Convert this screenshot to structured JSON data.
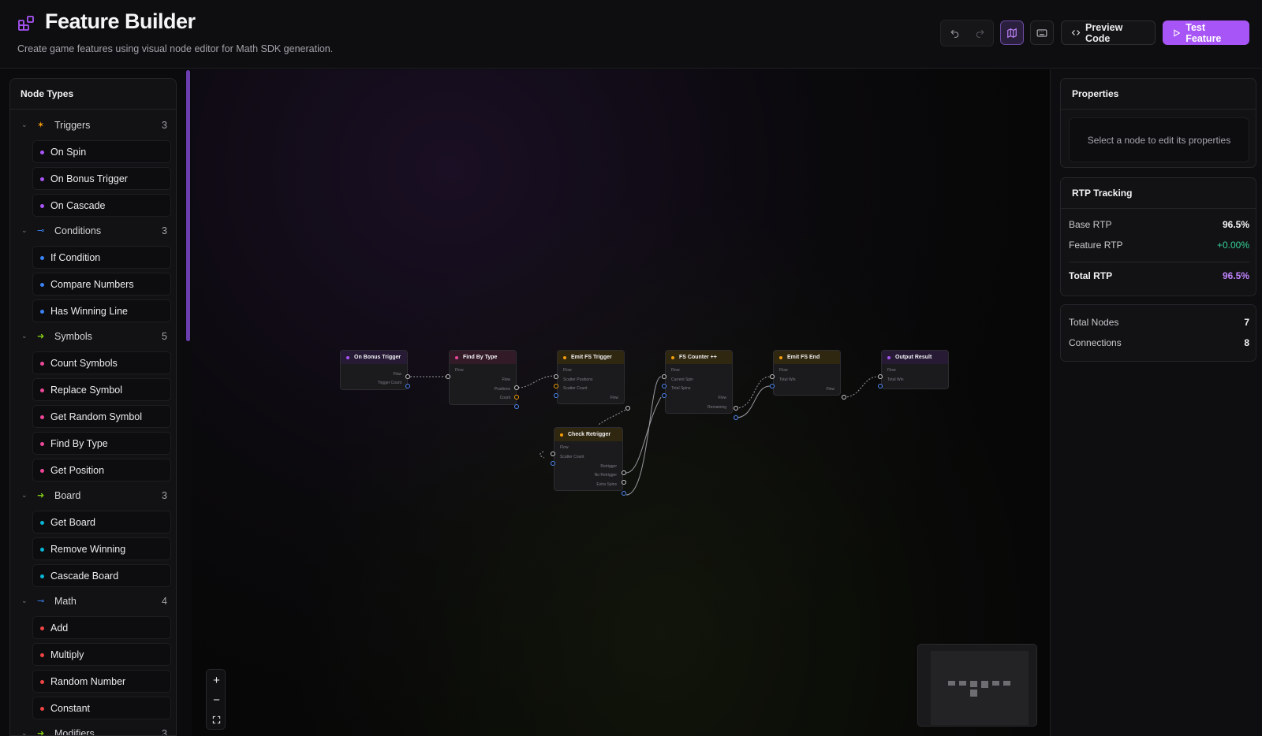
{
  "header": {
    "title": "Feature Builder",
    "subtitle": "Create game features using visual node editor for Math SDK generation.",
    "preview_code": "Preview Code",
    "test_feature": "Test Feature",
    "accent": "#a855f7"
  },
  "sidebar": {
    "title": "Node Types",
    "categories": [
      {
        "label": "Triggers",
        "count": "3",
        "icon": "sparkle-icon",
        "color": "#f59e0b",
        "items": [
          "On Spin",
          "On Bonus Trigger",
          "On Cascade"
        ],
        "dot": "#a855f7"
      },
      {
        "label": "Conditions",
        "count": "3",
        "icon": "branch-icon",
        "color": "#3b82f6",
        "items": [
          "If Condition",
          "Compare Numbers",
          "Has Winning Line"
        ],
        "dot": "#3b82f6"
      },
      {
        "label": "Symbols",
        "count": "5",
        "icon": "symbol-icon",
        "color": "#84cc16",
        "items": [
          "Count Symbols",
          "Replace Symbol",
          "Get Random Symbol",
          "Find By Type",
          "Get Position"
        ],
        "dot": "#ec4899"
      },
      {
        "label": "Board",
        "count": "3",
        "icon": "board-icon",
        "color": "#84cc16",
        "items": [
          "Get Board",
          "Remove Winning",
          "Cascade Board"
        ],
        "dot": "#06b6d4"
      },
      {
        "label": "Math",
        "count": "4",
        "icon": "math-icon",
        "color": "#3b82f6",
        "items": [
          "Add",
          "Multiply",
          "Random Number",
          "Constant"
        ],
        "dot": "#ef4444"
      },
      {
        "label": "Modifiers",
        "count": "3",
        "icon": "modifier-icon",
        "color": "#84cc16",
        "items": [],
        "dot": "#84cc16"
      }
    ]
  },
  "nodes": {
    "n1": {
      "title": "On Bonus Trigger",
      "p1": "Flow",
      "p2": "Trigger Count"
    },
    "n2": {
      "title": "Find By Type",
      "p1": "Flow",
      "p2": "Flow",
      "p3": "Positions",
      "p4": "Count"
    },
    "n3": {
      "title": "Emit FS Trigger",
      "p1": "Flow",
      "p2": "Scatter Positions",
      "p3": "Scatter Count",
      "p4": "Flow"
    },
    "n4": {
      "title": "FS Counter ++",
      "p1": "Flow",
      "p2": "Current Spin",
      "p3": "Total Spins",
      "p4": "Flow",
      "p5": "Remaining"
    },
    "n5": {
      "title": "Emit FS End",
      "p1": "Flow",
      "p2": "Total Win",
      "p3": "Flow"
    },
    "n6": {
      "title": "Output Result",
      "p1": "Flow",
      "p2": "Total Win"
    },
    "n7": {
      "title": "Check Retrigger",
      "p1": "Flow",
      "p2": "Scatter Count",
      "p3": "Retrigger",
      "p4": "No Retrigger",
      "p5": "Extra Spins"
    }
  },
  "properties": {
    "title": "Properties",
    "empty": "Select a node to edit its properties"
  },
  "rtp": {
    "title": "RTP Tracking",
    "base_label": "Base RTP",
    "base_value": "96.5%",
    "feature_label": "Feature RTP",
    "feature_value": "+0.00%",
    "total_label": "Total RTP",
    "total_value": "96.5%"
  },
  "stats": {
    "nodes_label": "Total Nodes",
    "nodes_value": "7",
    "conn_label": "Connections",
    "conn_value": "8"
  }
}
